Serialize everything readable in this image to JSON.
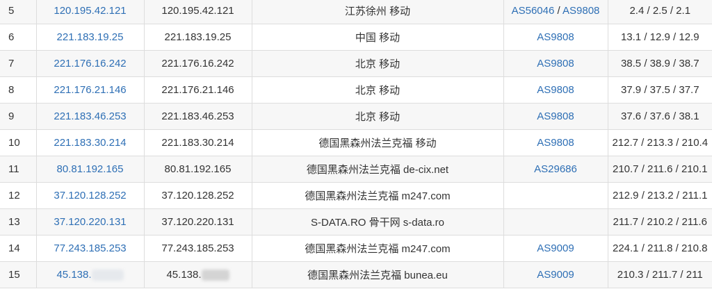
{
  "rows": [
    {
      "hop": "5",
      "ip_link": "120.195.42.121",
      "ip": "120.195.42.121",
      "location": "江苏徐州 移动",
      "as": [
        "AS56046",
        "AS9808"
      ],
      "rtt": "2.4 / 2.5 / 2.1"
    },
    {
      "hop": "6",
      "ip_link": "221.183.19.25",
      "ip": "221.183.19.25",
      "location": "中国 移动",
      "as": [
        "AS9808"
      ],
      "rtt": "13.1 / 12.9 / 12.9"
    },
    {
      "hop": "7",
      "ip_link": "221.176.16.242",
      "ip": "221.176.16.242",
      "location": "北京 移动",
      "as": [
        "AS9808"
      ],
      "rtt": "38.5 / 38.9 / 38.7"
    },
    {
      "hop": "8",
      "ip_link": "221.176.21.146",
      "ip": "221.176.21.146",
      "location": "北京 移动",
      "as": [
        "AS9808"
      ],
      "rtt": "37.9 / 37.5 / 37.7"
    },
    {
      "hop": "9",
      "ip_link": "221.183.46.253",
      "ip": "221.183.46.253",
      "location": "北京 移动",
      "as": [
        "AS9808"
      ],
      "rtt": "37.6 / 37.6 / 38.1"
    },
    {
      "hop": "10",
      "ip_link": "221.183.30.214",
      "ip": "221.183.30.214",
      "location": "德国黑森州法兰克福 移动",
      "as": [
        "AS9808"
      ],
      "rtt": "212.7 / 213.3 / 210.4"
    },
    {
      "hop": "11",
      "ip_link": "80.81.192.165",
      "ip": "80.81.192.165",
      "location": "德国黑森州法兰克福 de-cix.net",
      "as": [
        "AS29686"
      ],
      "rtt": "210.7 / 211.6 / 210.1"
    },
    {
      "hop": "12",
      "ip_link": "37.120.128.252",
      "ip": "37.120.128.252",
      "location": "德国黑森州法兰克福 m247.com",
      "as": [],
      "rtt": "212.9 / 213.2 / 211.1"
    },
    {
      "hop": "13",
      "ip_link": "37.120.220.131",
      "ip": "37.120.220.131",
      "location": "S-DATA.RO 骨干网 s-data.ro",
      "as": [],
      "rtt": "211.7 / 210.2 / 211.6"
    },
    {
      "hop": "14",
      "ip_link": "77.243.185.253",
      "ip": "77.243.185.253",
      "location": "德国黑森州法兰克福 m247.com",
      "as": [
        "AS9009"
      ],
      "rtt": "224.1 / 211.8 / 210.8"
    },
    {
      "hop": "15",
      "ip_link": "45.138.",
      "ip": "45.138.",
      "location": "德国黑森州法兰克福 bunea.eu",
      "as": [
        "AS9009"
      ],
      "rtt": "210.3 / 211.7 / 211"
    }
  ]
}
